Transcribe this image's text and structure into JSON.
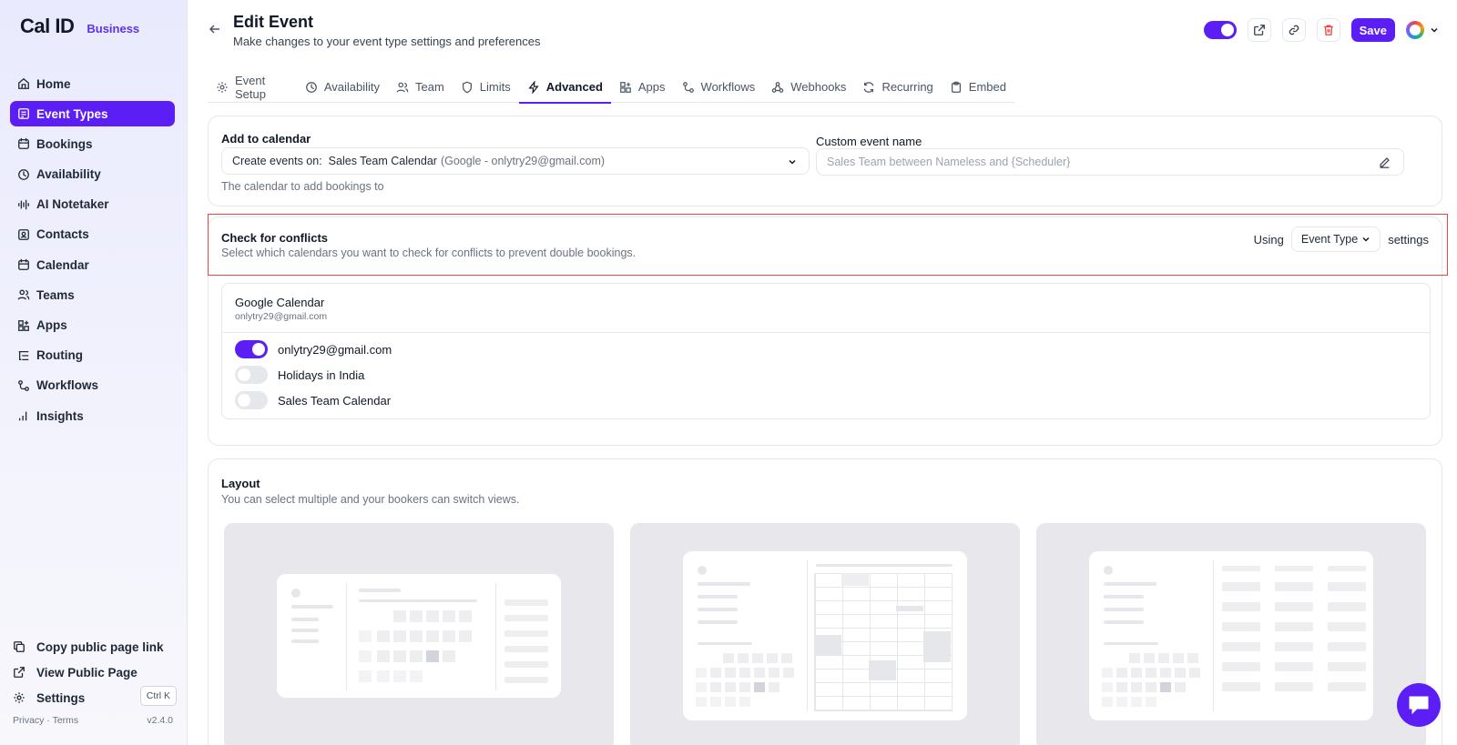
{
  "brand": {
    "logo": "Cal ID",
    "plan": "Business"
  },
  "sidebar": {
    "items": [
      {
        "label": "Home",
        "icon": "home-icon",
        "active": false
      },
      {
        "label": "Event Types",
        "icon": "event-types-icon",
        "active": true
      },
      {
        "label": "Bookings",
        "icon": "calendar-icon",
        "active": false
      },
      {
        "label": "Availability",
        "icon": "clock-icon",
        "active": false
      },
      {
        "label": "AI Notetaker",
        "icon": "waveform-icon",
        "active": false
      },
      {
        "label": "Contacts",
        "icon": "contact-card-icon",
        "active": false
      },
      {
        "label": "Calendar",
        "icon": "calendar-icon",
        "active": false
      },
      {
        "label": "Teams",
        "icon": "users-icon",
        "active": false
      },
      {
        "label": "Apps",
        "icon": "grid-plus-icon",
        "active": false
      },
      {
        "label": "Routing",
        "icon": "list-tree-icon",
        "active": false
      },
      {
        "label": "Workflows",
        "icon": "workflow-icon",
        "active": false
      },
      {
        "label": "Insights",
        "icon": "bar-chart-icon",
        "active": false
      }
    ],
    "footer": {
      "copy_link": "Copy public page link",
      "view_public": "View Public Page",
      "settings": "Settings",
      "settings_shortcut": "Ctrl K",
      "privacy_terms": "Privacy · Terms",
      "version": "v2.4.0"
    }
  },
  "header": {
    "title": "Edit Event",
    "subtitle": "Make changes to your event type settings and preferences",
    "save_label": "Save",
    "event_enabled": true
  },
  "tabs": [
    {
      "label": "Event Setup",
      "icon": "gear-icon",
      "active": false
    },
    {
      "label": "Availability",
      "icon": "clock-icon",
      "active": false
    },
    {
      "label": "Team",
      "icon": "users-icon",
      "active": false
    },
    {
      "label": "Limits",
      "icon": "shield-icon",
      "active": false
    },
    {
      "label": "Advanced",
      "icon": "bolt-icon",
      "active": true
    },
    {
      "label": "Apps",
      "icon": "grid-plus-icon",
      "active": false
    },
    {
      "label": "Workflows",
      "icon": "workflow-icon",
      "active": false
    },
    {
      "label": "Webhooks",
      "icon": "webhook-icon",
      "active": false
    },
    {
      "label": "Recurring",
      "icon": "refresh-icon",
      "active": false
    },
    {
      "label": "Embed",
      "icon": "clipboard-icon",
      "active": false
    }
  ],
  "add_to_calendar": {
    "label": "Add to calendar",
    "prefix": "Create events on:",
    "calendar_name": "Sales Team Calendar",
    "calendar_detail": "(Google - onlytry29@gmail.com)",
    "help": "The calendar to add bookings to"
  },
  "custom_event_name": {
    "label": "Custom event name",
    "placeholder": "Sales Team between Nameless and {Scheduler}"
  },
  "conflicts": {
    "title": "Check for conflicts",
    "description": "Select which calendars you want to check for conflicts to prevent double bookings.",
    "using_label": "Using",
    "mode": "Event Type",
    "settings_label": "settings",
    "provider": "Google Calendar",
    "account": "onlytry29@gmail.com",
    "calendars": [
      {
        "name": "onlytry29@gmail.com",
        "enabled": true
      },
      {
        "name": "Holidays in India",
        "enabled": false
      },
      {
        "name": "Sales Team Calendar",
        "enabled": false
      }
    ]
  },
  "layout": {
    "title": "Layout",
    "description": "You can select multiple and your bookers can switch views."
  },
  "colors": {
    "accent": "#5b1ff5",
    "highlight": "#ef4444"
  }
}
